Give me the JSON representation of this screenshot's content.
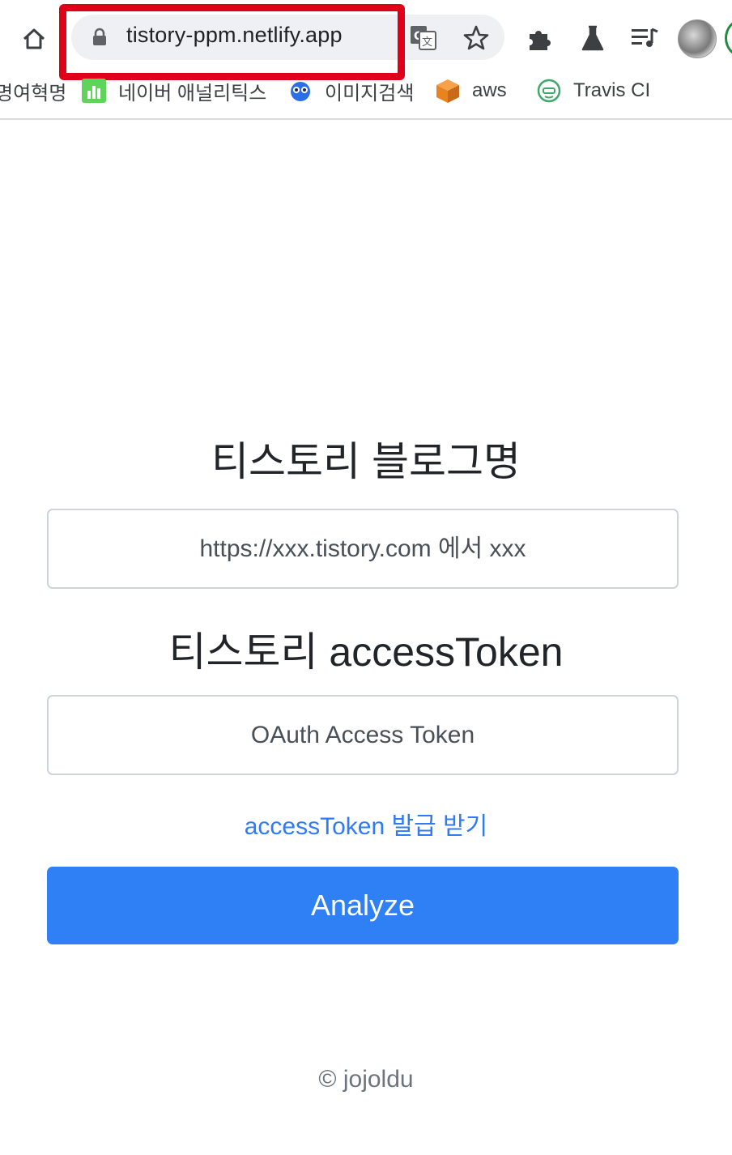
{
  "browser": {
    "url": "tistory-ppm.netlify.app",
    "bookmarks": [
      {
        "label": "명여혁명",
        "icon": "none"
      },
      {
        "label": "네이버 애널리틱스",
        "icon": "analytics-icon"
      },
      {
        "label": "이미지검색",
        "icon": "image-search-icon"
      },
      {
        "label": "aws",
        "icon": "aws-cube-icon"
      },
      {
        "label": "Travis CI",
        "icon": "travis-icon"
      }
    ],
    "colors": {
      "highlight": "#e0001a"
    }
  },
  "form": {
    "blog_heading": "티스토리 블로그명",
    "blog_placeholder": "https://xxx.tistory.com 에서 xxx",
    "token_heading": "티스토리 accessToken",
    "token_placeholder": "OAuth Access Token",
    "token_link": "accessToken 발급 받기",
    "submit_label": "Analyze"
  },
  "footer": {
    "text": "© jojoldu"
  },
  "colors": {
    "primary": "#3080f5",
    "link": "#2f7bf5"
  }
}
